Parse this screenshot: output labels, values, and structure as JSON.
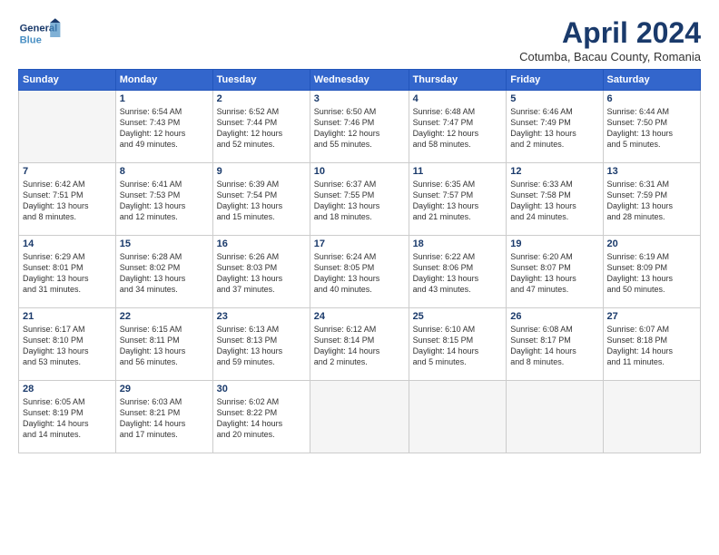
{
  "header": {
    "logo_line1": "General",
    "logo_line2": "Blue",
    "month": "April 2024",
    "location": "Cotumba, Bacau County, Romania"
  },
  "weekdays": [
    "Sunday",
    "Monday",
    "Tuesday",
    "Wednesday",
    "Thursday",
    "Friday",
    "Saturday"
  ],
  "weeks": [
    [
      {
        "day": "",
        "info": ""
      },
      {
        "day": "1",
        "info": "Sunrise: 6:54 AM\nSunset: 7:43 PM\nDaylight: 12 hours\nand 49 minutes."
      },
      {
        "day": "2",
        "info": "Sunrise: 6:52 AM\nSunset: 7:44 PM\nDaylight: 12 hours\nand 52 minutes."
      },
      {
        "day": "3",
        "info": "Sunrise: 6:50 AM\nSunset: 7:46 PM\nDaylight: 12 hours\nand 55 minutes."
      },
      {
        "day": "4",
        "info": "Sunrise: 6:48 AM\nSunset: 7:47 PM\nDaylight: 12 hours\nand 58 minutes."
      },
      {
        "day": "5",
        "info": "Sunrise: 6:46 AM\nSunset: 7:49 PM\nDaylight: 13 hours\nand 2 minutes."
      },
      {
        "day": "6",
        "info": "Sunrise: 6:44 AM\nSunset: 7:50 PM\nDaylight: 13 hours\nand 5 minutes."
      }
    ],
    [
      {
        "day": "7",
        "info": "Sunrise: 6:42 AM\nSunset: 7:51 PM\nDaylight: 13 hours\nand 8 minutes."
      },
      {
        "day": "8",
        "info": "Sunrise: 6:41 AM\nSunset: 7:53 PM\nDaylight: 13 hours\nand 12 minutes."
      },
      {
        "day": "9",
        "info": "Sunrise: 6:39 AM\nSunset: 7:54 PM\nDaylight: 13 hours\nand 15 minutes."
      },
      {
        "day": "10",
        "info": "Sunrise: 6:37 AM\nSunset: 7:55 PM\nDaylight: 13 hours\nand 18 minutes."
      },
      {
        "day": "11",
        "info": "Sunrise: 6:35 AM\nSunset: 7:57 PM\nDaylight: 13 hours\nand 21 minutes."
      },
      {
        "day": "12",
        "info": "Sunrise: 6:33 AM\nSunset: 7:58 PM\nDaylight: 13 hours\nand 24 minutes."
      },
      {
        "day": "13",
        "info": "Sunrise: 6:31 AM\nSunset: 7:59 PM\nDaylight: 13 hours\nand 28 minutes."
      }
    ],
    [
      {
        "day": "14",
        "info": "Sunrise: 6:29 AM\nSunset: 8:01 PM\nDaylight: 13 hours\nand 31 minutes."
      },
      {
        "day": "15",
        "info": "Sunrise: 6:28 AM\nSunset: 8:02 PM\nDaylight: 13 hours\nand 34 minutes."
      },
      {
        "day": "16",
        "info": "Sunrise: 6:26 AM\nSunset: 8:03 PM\nDaylight: 13 hours\nand 37 minutes."
      },
      {
        "day": "17",
        "info": "Sunrise: 6:24 AM\nSunset: 8:05 PM\nDaylight: 13 hours\nand 40 minutes."
      },
      {
        "day": "18",
        "info": "Sunrise: 6:22 AM\nSunset: 8:06 PM\nDaylight: 13 hours\nand 43 minutes."
      },
      {
        "day": "19",
        "info": "Sunrise: 6:20 AM\nSunset: 8:07 PM\nDaylight: 13 hours\nand 47 minutes."
      },
      {
        "day": "20",
        "info": "Sunrise: 6:19 AM\nSunset: 8:09 PM\nDaylight: 13 hours\nand 50 minutes."
      }
    ],
    [
      {
        "day": "21",
        "info": "Sunrise: 6:17 AM\nSunset: 8:10 PM\nDaylight: 13 hours\nand 53 minutes."
      },
      {
        "day": "22",
        "info": "Sunrise: 6:15 AM\nSunset: 8:11 PM\nDaylight: 13 hours\nand 56 minutes."
      },
      {
        "day": "23",
        "info": "Sunrise: 6:13 AM\nSunset: 8:13 PM\nDaylight: 13 hours\nand 59 minutes."
      },
      {
        "day": "24",
        "info": "Sunrise: 6:12 AM\nSunset: 8:14 PM\nDaylight: 14 hours\nand 2 minutes."
      },
      {
        "day": "25",
        "info": "Sunrise: 6:10 AM\nSunset: 8:15 PM\nDaylight: 14 hours\nand 5 minutes."
      },
      {
        "day": "26",
        "info": "Sunrise: 6:08 AM\nSunset: 8:17 PM\nDaylight: 14 hours\nand 8 minutes."
      },
      {
        "day": "27",
        "info": "Sunrise: 6:07 AM\nSunset: 8:18 PM\nDaylight: 14 hours\nand 11 minutes."
      }
    ],
    [
      {
        "day": "28",
        "info": "Sunrise: 6:05 AM\nSunset: 8:19 PM\nDaylight: 14 hours\nand 14 minutes."
      },
      {
        "day": "29",
        "info": "Sunrise: 6:03 AM\nSunset: 8:21 PM\nDaylight: 14 hours\nand 17 minutes."
      },
      {
        "day": "30",
        "info": "Sunrise: 6:02 AM\nSunset: 8:22 PM\nDaylight: 14 hours\nand 20 minutes."
      },
      {
        "day": "",
        "info": ""
      },
      {
        "day": "",
        "info": ""
      },
      {
        "day": "",
        "info": ""
      },
      {
        "day": "",
        "info": ""
      }
    ]
  ]
}
